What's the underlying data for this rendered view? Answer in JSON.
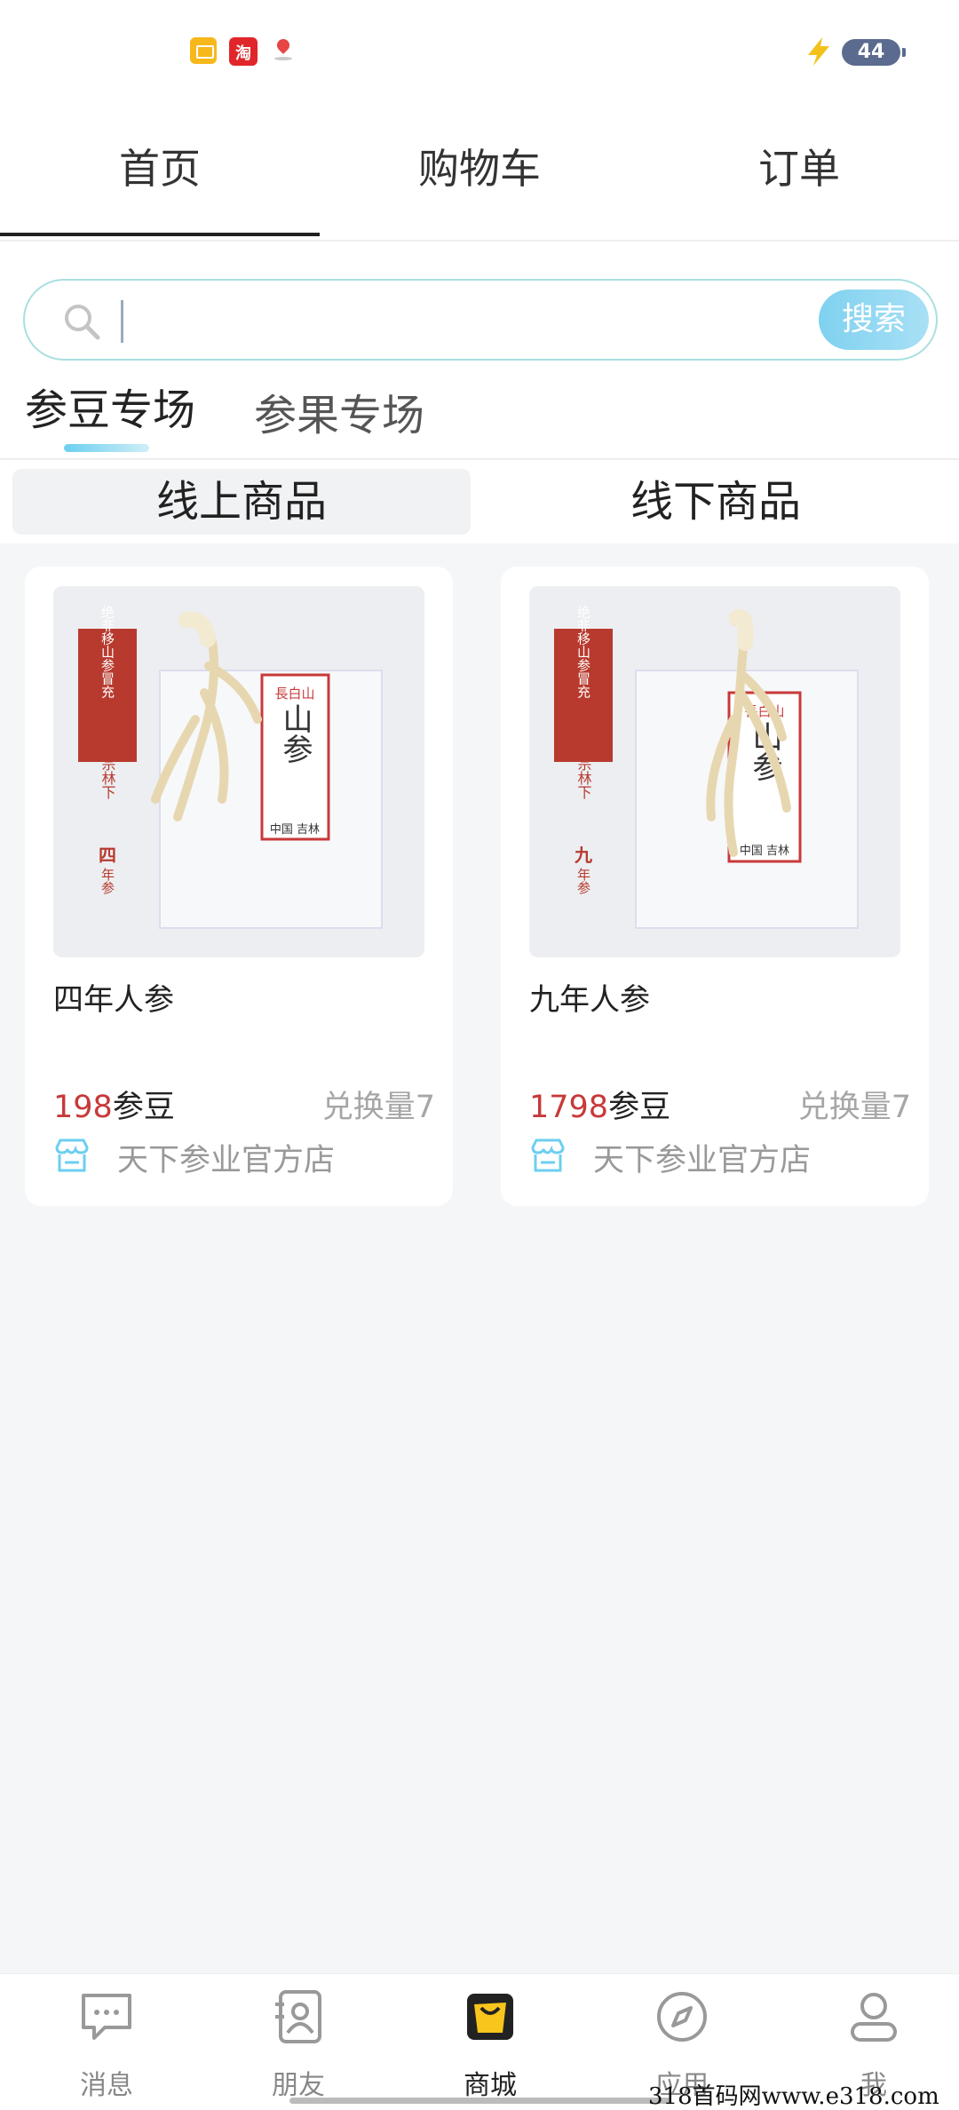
{
  "status_bar": {
    "battery": "44"
  },
  "top_tabs": [
    {
      "label": "首页"
    },
    {
      "label": "购物车"
    },
    {
      "label": "订单"
    }
  ],
  "search": {
    "placeholder": "",
    "button_label": "搜索"
  },
  "category_tabs": [
    {
      "label": "参豆专场"
    },
    {
      "label": "参果专场"
    }
  ],
  "segments": [
    {
      "label": "线上商品"
    },
    {
      "label": "线下商品"
    }
  ],
  "products": [
    {
      "title": "四年人参",
      "price": "198",
      "currency": "参豆",
      "exchange": "兑换量7",
      "shop": "天下参业官方店",
      "package": {
        "side": "绝非移山参冒充",
        "side2": "正宗林下",
        "years": "四",
        "unit": "年参",
        "brand": "長白山",
        "big": "山参",
        "origin": "中国 吉林"
      }
    },
    {
      "title": "九年人参",
      "price": "1798",
      "currency": "参豆",
      "exchange": "兑换量7",
      "shop": "天下参业官方店",
      "package": {
        "side": "绝非移山参冒充",
        "side2": "正宗林下",
        "years": "九",
        "unit": "年参",
        "brand": "長白山",
        "big": "山参",
        "origin": "中国 吉林"
      }
    }
  ],
  "bottom_nav": [
    {
      "label": "消息",
      "icon": "message-icon"
    },
    {
      "label": "朋友",
      "icon": "contacts-icon"
    },
    {
      "label": "商城",
      "icon": "mall-icon"
    },
    {
      "label": "应用",
      "icon": "compass-icon"
    },
    {
      "label": "我",
      "icon": "profile-icon"
    }
  ],
  "watermark": {
    "prefix": "318首码网",
    "site": "318首码网www.e318.com"
  },
  "colors": {
    "accent": "#7fd1f0",
    "price": "#c8393a",
    "active_nav": "#f7c51c"
  }
}
